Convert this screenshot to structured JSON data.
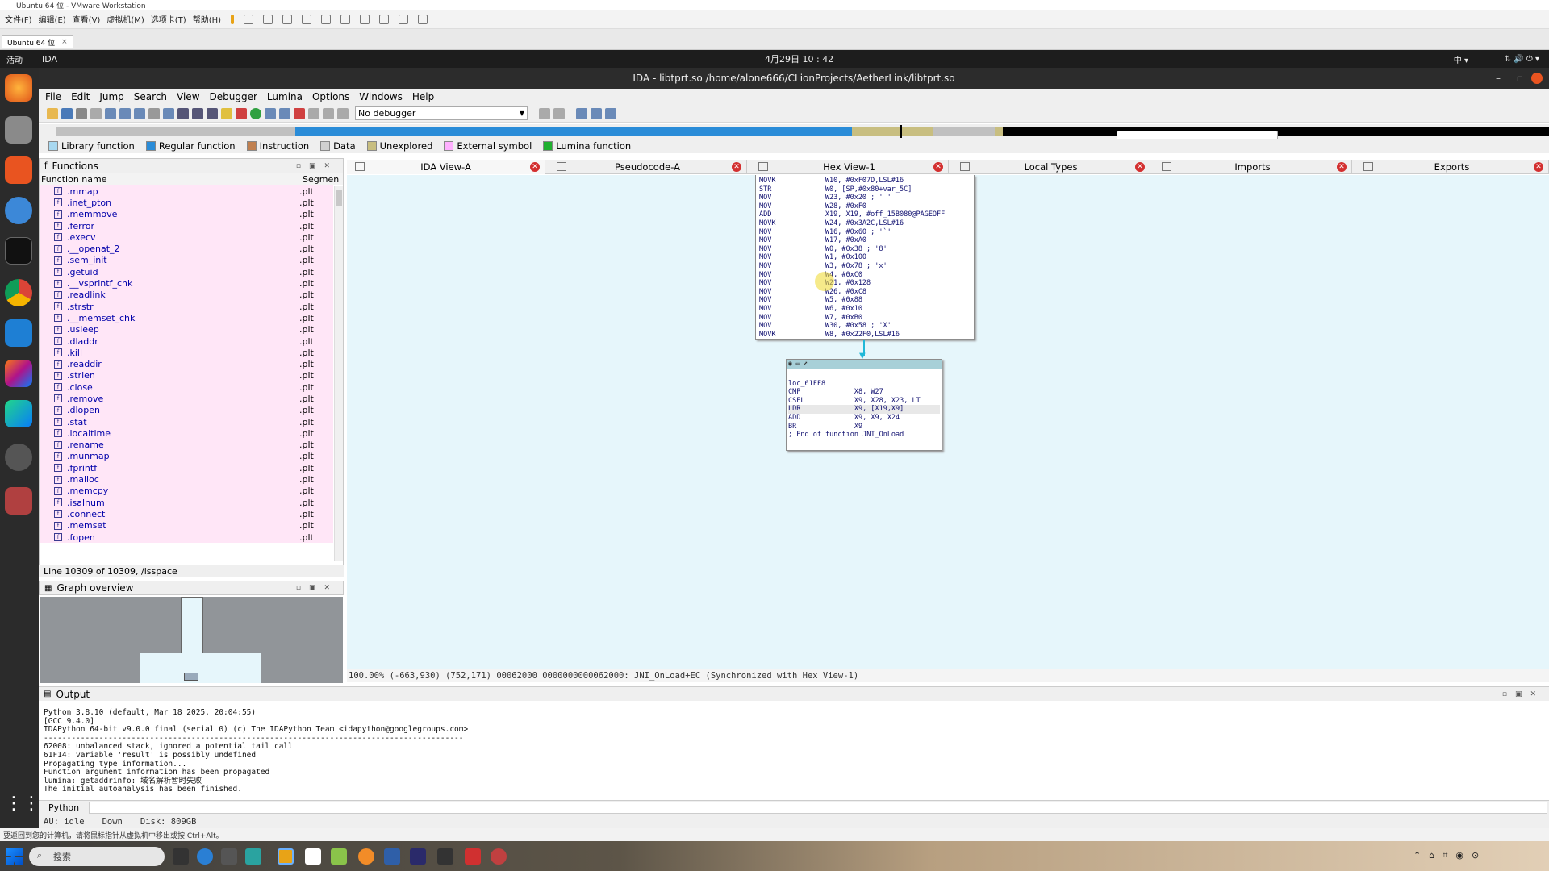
{
  "vm": {
    "title": "Ubuntu 64 位 - VMware Workstation",
    "menu": [
      "文件(F)",
      "编辑(E)",
      "查看(V)",
      "虚拟机(M)",
      "选项卡(T)",
      "帮助(H)"
    ],
    "tab": "Ubuntu 64 位"
  },
  "ubuntu": {
    "activities": "活动",
    "app": "IDA",
    "clock": "4月29日  10 : 42"
  },
  "ida": {
    "title": "IDA - libtprt.so /home/alone666/CLionProjects/AetherLink/libtprt.so",
    "menu": [
      "File",
      "Edit",
      "Jump",
      "Search",
      "View",
      "Debugger",
      "Lumina",
      "Options",
      "Windows",
      "Help"
    ],
    "debugger": "No debugger",
    "legend": [
      "Library function",
      "Regular function",
      "Instruction",
      "Data",
      "Unexplored",
      "External symbol",
      "Lumina function"
    ],
    "legend_colors": [
      "#a8d8f0",
      "#2a8cd8",
      "#c08050",
      "#d0d0d0",
      "#c8be80",
      "#ffb0ff",
      "#20b030"
    ]
  },
  "functions": {
    "title": "Functions",
    "col_name": "Function name",
    "col_seg": "Segmen",
    "rows": [
      {
        "name": ".mmap",
        "seg": ".plt"
      },
      {
        "name": ".inet_pton",
        "seg": ".plt"
      },
      {
        "name": ".memmove",
        "seg": ".plt"
      },
      {
        "name": ".ferror",
        "seg": ".plt"
      },
      {
        "name": ".execv",
        "seg": ".plt"
      },
      {
        "name": ".__openat_2",
        "seg": ".plt"
      },
      {
        "name": ".sem_init",
        "seg": ".plt"
      },
      {
        "name": ".getuid",
        "seg": ".plt"
      },
      {
        "name": ".__vsprintf_chk",
        "seg": ".plt"
      },
      {
        "name": ".readlink",
        "seg": ".plt"
      },
      {
        "name": ".strstr",
        "seg": ".plt"
      },
      {
        "name": ".__memset_chk",
        "seg": ".plt"
      },
      {
        "name": ".usleep",
        "seg": ".plt"
      },
      {
        "name": ".dladdr",
        "seg": ".plt"
      },
      {
        "name": ".kill",
        "seg": ".plt"
      },
      {
        "name": ".readdir",
        "seg": ".plt"
      },
      {
        "name": ".strlen",
        "seg": ".plt"
      },
      {
        "name": ".close",
        "seg": ".plt"
      },
      {
        "name": ".remove",
        "seg": ".plt"
      },
      {
        "name": ".dlopen",
        "seg": ".plt"
      },
      {
        "name": ".stat",
        "seg": ".plt"
      },
      {
        "name": ".localtime",
        "seg": ".plt"
      },
      {
        "name": ".rename",
        "seg": ".plt"
      },
      {
        "name": ".munmap",
        "seg": ".plt"
      },
      {
        "name": ".fprintf",
        "seg": ".plt"
      },
      {
        "name": ".malloc",
        "seg": ".plt"
      },
      {
        "name": ".memcpy",
        "seg": ".plt"
      },
      {
        "name": ".isalnum",
        "seg": ".plt"
      },
      {
        "name": ".connect",
        "seg": ".plt"
      },
      {
        "name": ".memset",
        "seg": ".plt"
      },
      {
        "name": ".fopen",
        "seg": ".plt"
      }
    ],
    "status": "Line 10309 of 10309, /isspace"
  },
  "graph_overview": {
    "title": "Graph overview"
  },
  "tabs": [
    {
      "label": "IDA View-A"
    },
    {
      "label": "Pseudocode-A"
    },
    {
      "label": "Hex View-1"
    },
    {
      "label": "Local Types"
    },
    {
      "label": "Imports"
    },
    {
      "label": "Exports"
    }
  ],
  "graph": {
    "block1": [
      "MOVK            W10, #0xF07D,LSL#16",
      "STR             W0, [SP,#0x80+var_5C]",
      "MOV             W23, #0x20 ; ' '",
      "MOV             W28, #0xF0",
      "ADD             X19, X19, #off_15B080@PAGEOFF",
      "MOVK            W24, #0x3A2C,LSL#16",
      "MOV             W16, #0x60 ; '`'",
      "MOV             W17, #0xA0",
      "MOV             W0, #0x38 ; '8'",
      "MOV             W1, #0x100",
      "MOV             W3, #0x78 ; 'x'",
      "MOV             W4, #0xC0",
      "MOV             W21, #0x128",
      "MOV             W26, #0xC8",
      "MOV             W5, #0x88",
      "MOV             W6, #0x10",
      "MOV             W7, #0xB0",
      "MOV             W30, #0x58 ; 'X'",
      "MOVK            W8, #0x22F0,LSL#16"
    ],
    "block2": [
      "",
      "loc_61FF8",
      "CMP             X8, W27",
      "CSEL            X9, X28, X23, LT",
      "LDR             X9, [X19,X9]",
      "ADD             X9, X9, X24",
      "BR              X9",
      "; End of function JNI_OnLoad"
    ],
    "status": "100.00% (-663,930) (752,171) 00062000 0000000000062000: JNI_OnLoad+EC (Synchronized with Hex View-1)"
  },
  "output": {
    "title": "Output",
    "lines": [
      "Python 3.8.10 (default, Mar 18 2025, 20:04:55)",
      "[GCC 9.4.0]",
      "IDAPython 64-bit v9.0.0 final (serial 0) (c) The IDAPython Team <idapython@googlegroups.com>",
      "-------------------------------------------------------------------------------------------",
      "62008: unbalanced stack, ignored a potential tail call",
      "61F14: variable 'result' is possibly undefined",
      "Propagating type information...",
      "Function argument information has been propagated",
      "lumina: getaddrinfo: 域名解析暂时失败",
      "The initial autoanalysis has been finished."
    ],
    "lang": "Python"
  },
  "status": {
    "au": "AU:  idle",
    "dir": "Down",
    "disk": "Disk: 809GB"
  },
  "vm_status": "要返回到您的计算机，请将鼠标指针从虚拟机中移出或按 Ctrl+Alt。",
  "taskbar": {
    "search": "搜索"
  }
}
